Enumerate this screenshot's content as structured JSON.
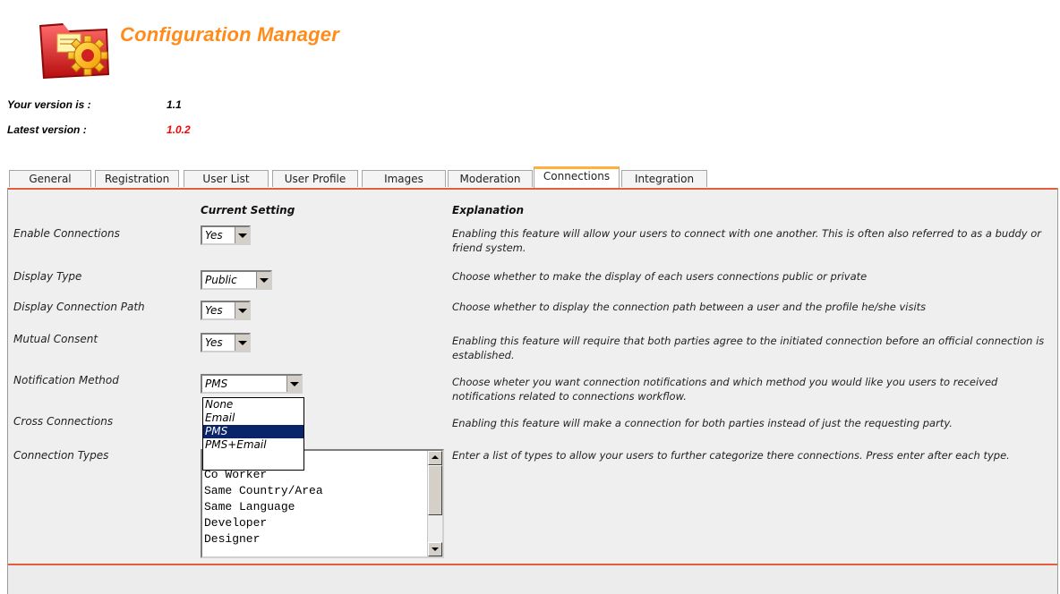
{
  "header": {
    "title": "Configuration Manager",
    "your_version_label": "Your version is :",
    "your_version_value": "1.1",
    "latest_version_label": "Latest version :",
    "latest_version_value": "1.0.2",
    "latest_version_color": "#ff0000",
    "title_color": "#ff8c1a"
  },
  "tabs": [
    {
      "label": "General"
    },
    {
      "label": "Registration"
    },
    {
      "label": "User List"
    },
    {
      "label": "User Profile"
    },
    {
      "label": "Images"
    },
    {
      "label": "Moderation"
    },
    {
      "label": "Connections",
      "active": true
    },
    {
      "label": "Integration"
    }
  ],
  "table": {
    "col_current": "Current Setting",
    "col_explanation": "Explanation",
    "rows": [
      {
        "label": "Enable Connections",
        "value": "Yes",
        "explanation": "Enabling this feature will allow your users to connect with one another. This is often also referred to as a buddy or friend system."
      },
      {
        "label": "Display Type",
        "value": "Public",
        "explanation": "Choose whether to make the display of each users connections public or private"
      },
      {
        "label": "Display Connection Path",
        "value": "Yes",
        "explanation": "Choose whether to display the connection path between a user and the profile he/she visits"
      },
      {
        "label": "Mutual Consent",
        "value": "Yes",
        "explanation": "Enabling this feature will require that both parties agree to the initiated connection before an official connection is established."
      },
      {
        "label": "Notification Method",
        "value": "PMS",
        "explanation": "Choose wheter you want connection notifications and which method you would like you users to received notifications related to connections workflow."
      },
      {
        "label": "Cross Connections",
        "explanation": "Enabling this feature will make a connection for both parties instead of just the requesting party."
      },
      {
        "label": "Connection Types",
        "explanation": "Enter a list of types to allow your users to further categorize there connections. Press enter after each type."
      }
    ]
  },
  "notification_dropdown": {
    "options": [
      "None",
      "Email",
      "PMS",
      "PMS+Email"
    ],
    "highlighted": "PMS"
  },
  "connection_types": [
    "Co Worker",
    "Same Country/Area",
    "Same Language",
    "Developer",
    "Designer"
  ],
  "colors": {
    "accent_line": "#e65c3c",
    "active_tab_top": "#ffb13c",
    "selection": "#0a246a"
  }
}
